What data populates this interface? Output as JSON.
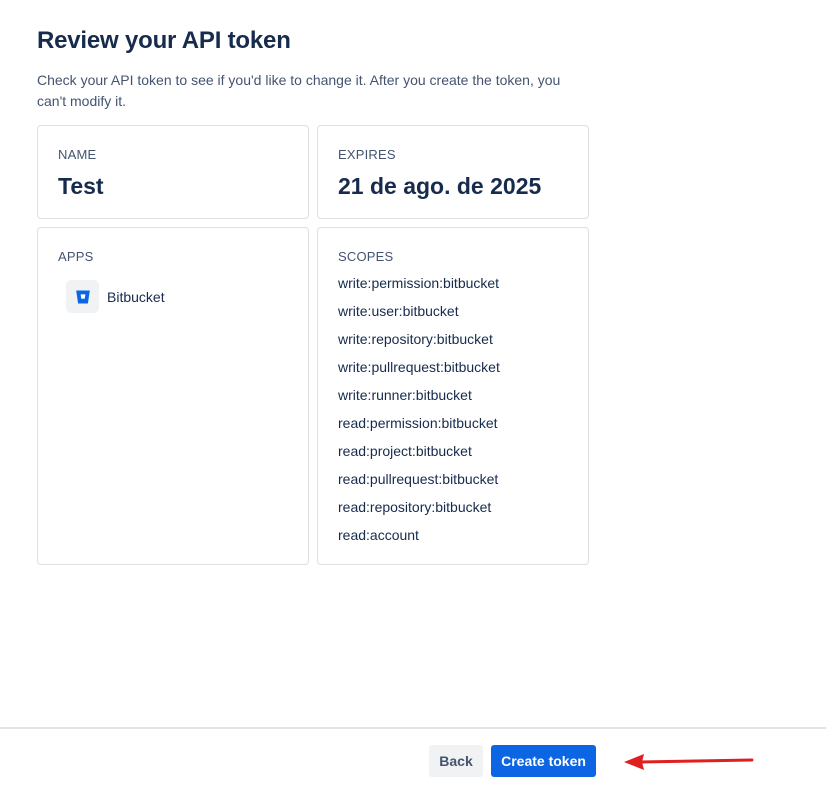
{
  "header": {
    "title": "Review your API token",
    "description": "Check your API token to see if you'd like to change it. After you create the token, you can't modify it."
  },
  "name_card": {
    "label": "NAME",
    "value": "Test"
  },
  "expires_card": {
    "label": "EXPIRES",
    "value": "21 de ago. de 2025"
  },
  "apps_card": {
    "label": "APPS",
    "apps": [
      {
        "name": "Bitbucket",
        "icon": "bitbucket-icon"
      }
    ]
  },
  "scopes_card": {
    "label": "SCOPES",
    "scopes": [
      "write:permission:bitbucket",
      "write:user:bitbucket",
      "write:repository:bitbucket",
      "write:pullrequest:bitbucket",
      "write:runner:bitbucket",
      "read:permission:bitbucket",
      "read:project:bitbucket",
      "read:pullrequest:bitbucket",
      "read:repository:bitbucket",
      "read:account"
    ]
  },
  "footer": {
    "back_label": "Back",
    "create_label": "Create token"
  },
  "colors": {
    "primary": "#0c66e4",
    "annotation_arrow": "#e02020"
  }
}
